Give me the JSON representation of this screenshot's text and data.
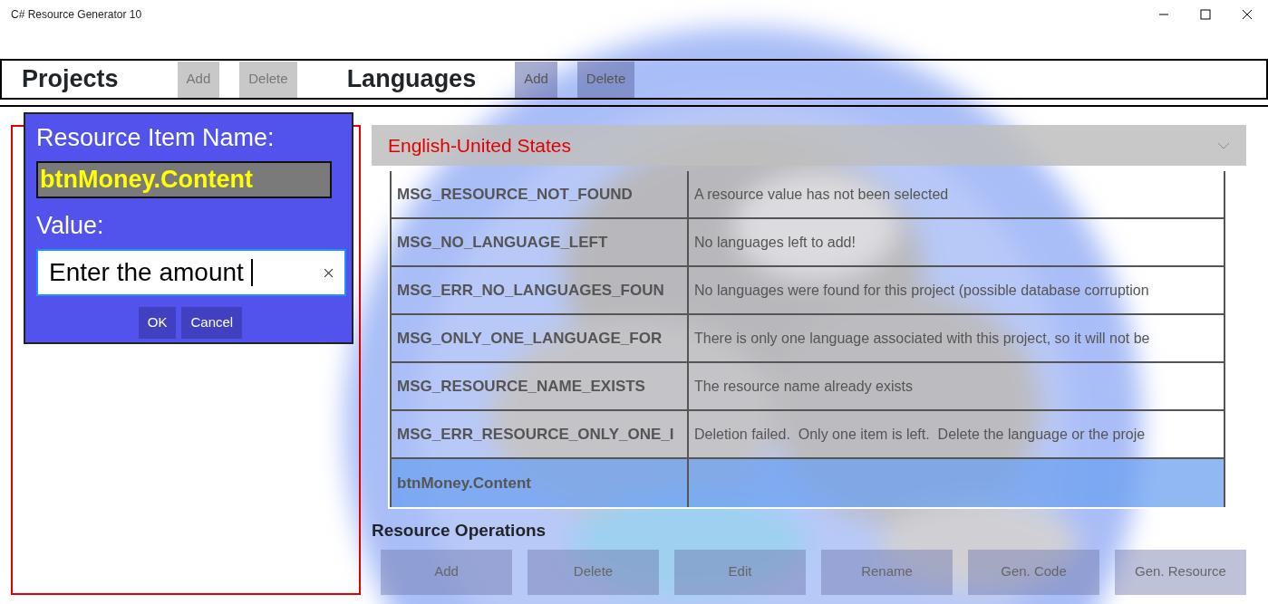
{
  "window": {
    "title": "C# Resource Generator 10"
  },
  "header": {
    "projects_label": "Projects",
    "project_buttons": [
      "Add",
      "Delete"
    ],
    "languages_label": "Languages",
    "language_buttons": [
      "Add",
      "Delete"
    ]
  },
  "dialog": {
    "name_label": "Resource Item Name:",
    "name_value": "btnMoney.Content",
    "value_label": "Value:",
    "value": "Enter the amount",
    "buttons": [
      "OK",
      "Cancel"
    ]
  },
  "language_select": {
    "value": "English-United States"
  },
  "table": {
    "rows": [
      {
        "name": "MSG_RESOURCE_NOT_FOUND",
        "value": "A resource value has not been selected",
        "selected": false
      },
      {
        "name": "MSG_NO_LANGUAGE_LEFT",
        "value": "No languages left to add!",
        "selected": false
      },
      {
        "name": "MSG_ERR_NO_LANGUAGES_FOUN",
        "value": "No languages were found for this project (possible database corruption",
        "selected": false
      },
      {
        "name": "MSG_ONLY_ONE_LANGUAGE_FOR",
        "value": "There is only one language associated with this project, so it will not be",
        "selected": false
      },
      {
        "name": "MSG_RESOURCE_NAME_EXISTS",
        "value": "The resource name already exists",
        "selected": false
      },
      {
        "name": "MSG_ERR_RESOURCE_ONLY_ONE_I",
        "value": "Deletion failed.  Only one item is left.  Delete the language or the proje",
        "selected": false
      },
      {
        "name": "btnMoney.Content",
        "value": "",
        "selected": true
      }
    ]
  },
  "operations": {
    "title": "Resource Operations",
    "buttons": [
      "Add",
      "Delete",
      "Edit",
      "Rename",
      "Gen. Code",
      "Gen. Resource"
    ]
  }
}
